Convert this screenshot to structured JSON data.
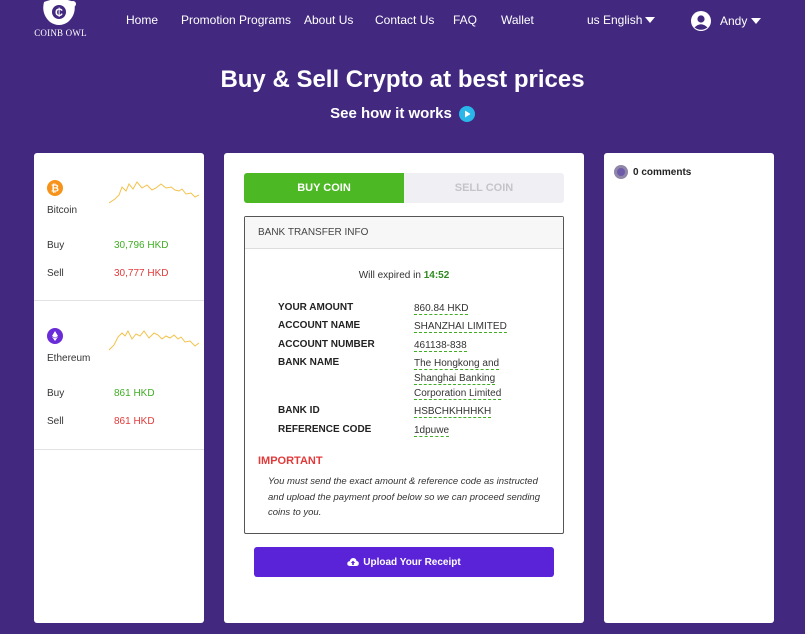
{
  "brand": {
    "logo_text": "COINB OWL"
  },
  "nav": {
    "items": [
      "Home",
      "Promotion Programs",
      "About Us",
      "Contact Us",
      "FAQ",
      "Wallet"
    ],
    "language": "us English",
    "user_name": "Andy"
  },
  "hero": {
    "title": "Buy & Sell Crypto at best prices",
    "subtitle": "See how it works"
  },
  "prices": {
    "coins": [
      {
        "name": "Bitcoin",
        "icon": "bitcoin-icon",
        "color": "#f7931a",
        "buy_label": "Buy",
        "buy": "30,796 HKD",
        "sell_label": "Sell",
        "sell": "30,777 HKD"
      },
      {
        "name": "Ethereum",
        "icon": "ethereum-icon",
        "color": "#6a2bd8",
        "buy_label": "Buy",
        "buy": "861 HKD",
        "sell_label": "Sell",
        "sell": "861 HKD"
      }
    ]
  },
  "trade": {
    "tab_buy": "BUY COIN",
    "tab_sell": "SELL COIN",
    "active_tab": "BUY COIN",
    "bank_header": "BANK TRANSFER INFO",
    "expire_label": "Will expired in",
    "expire_time": "14:52",
    "fields": [
      {
        "label": "YOUR AMOUNT",
        "value": "860.84 HKD"
      },
      {
        "label": "ACCOUNT NAME",
        "value": "SHANZHAI LIMITED"
      },
      {
        "label": "ACCOUNT NUMBER",
        "value": "461138-838"
      },
      {
        "label": "BANK NAME",
        "value": "The Hongkong and Shanghai Banking Corporation Limited"
      },
      {
        "label": "BANK ID",
        "value": "HSBCHKHHHKH"
      },
      {
        "label": "REFERENCE CODE",
        "value": "1dpuwe"
      }
    ],
    "important_label": "IMPORTANT",
    "important_note": "You must send the exact amount & reference code as instructed and upload the payment proof below so we can proceed sending coins to you.",
    "upload_label": "Upload Your Receipt"
  },
  "comments": {
    "count_label": "0 comments"
  },
  "colors": {
    "background": "#42297f",
    "buy_green": "#4cb823",
    "sell_red": "#e23a3a",
    "upload_purple": "#5a23d8",
    "accent_cyan": "#29b6e8"
  }
}
